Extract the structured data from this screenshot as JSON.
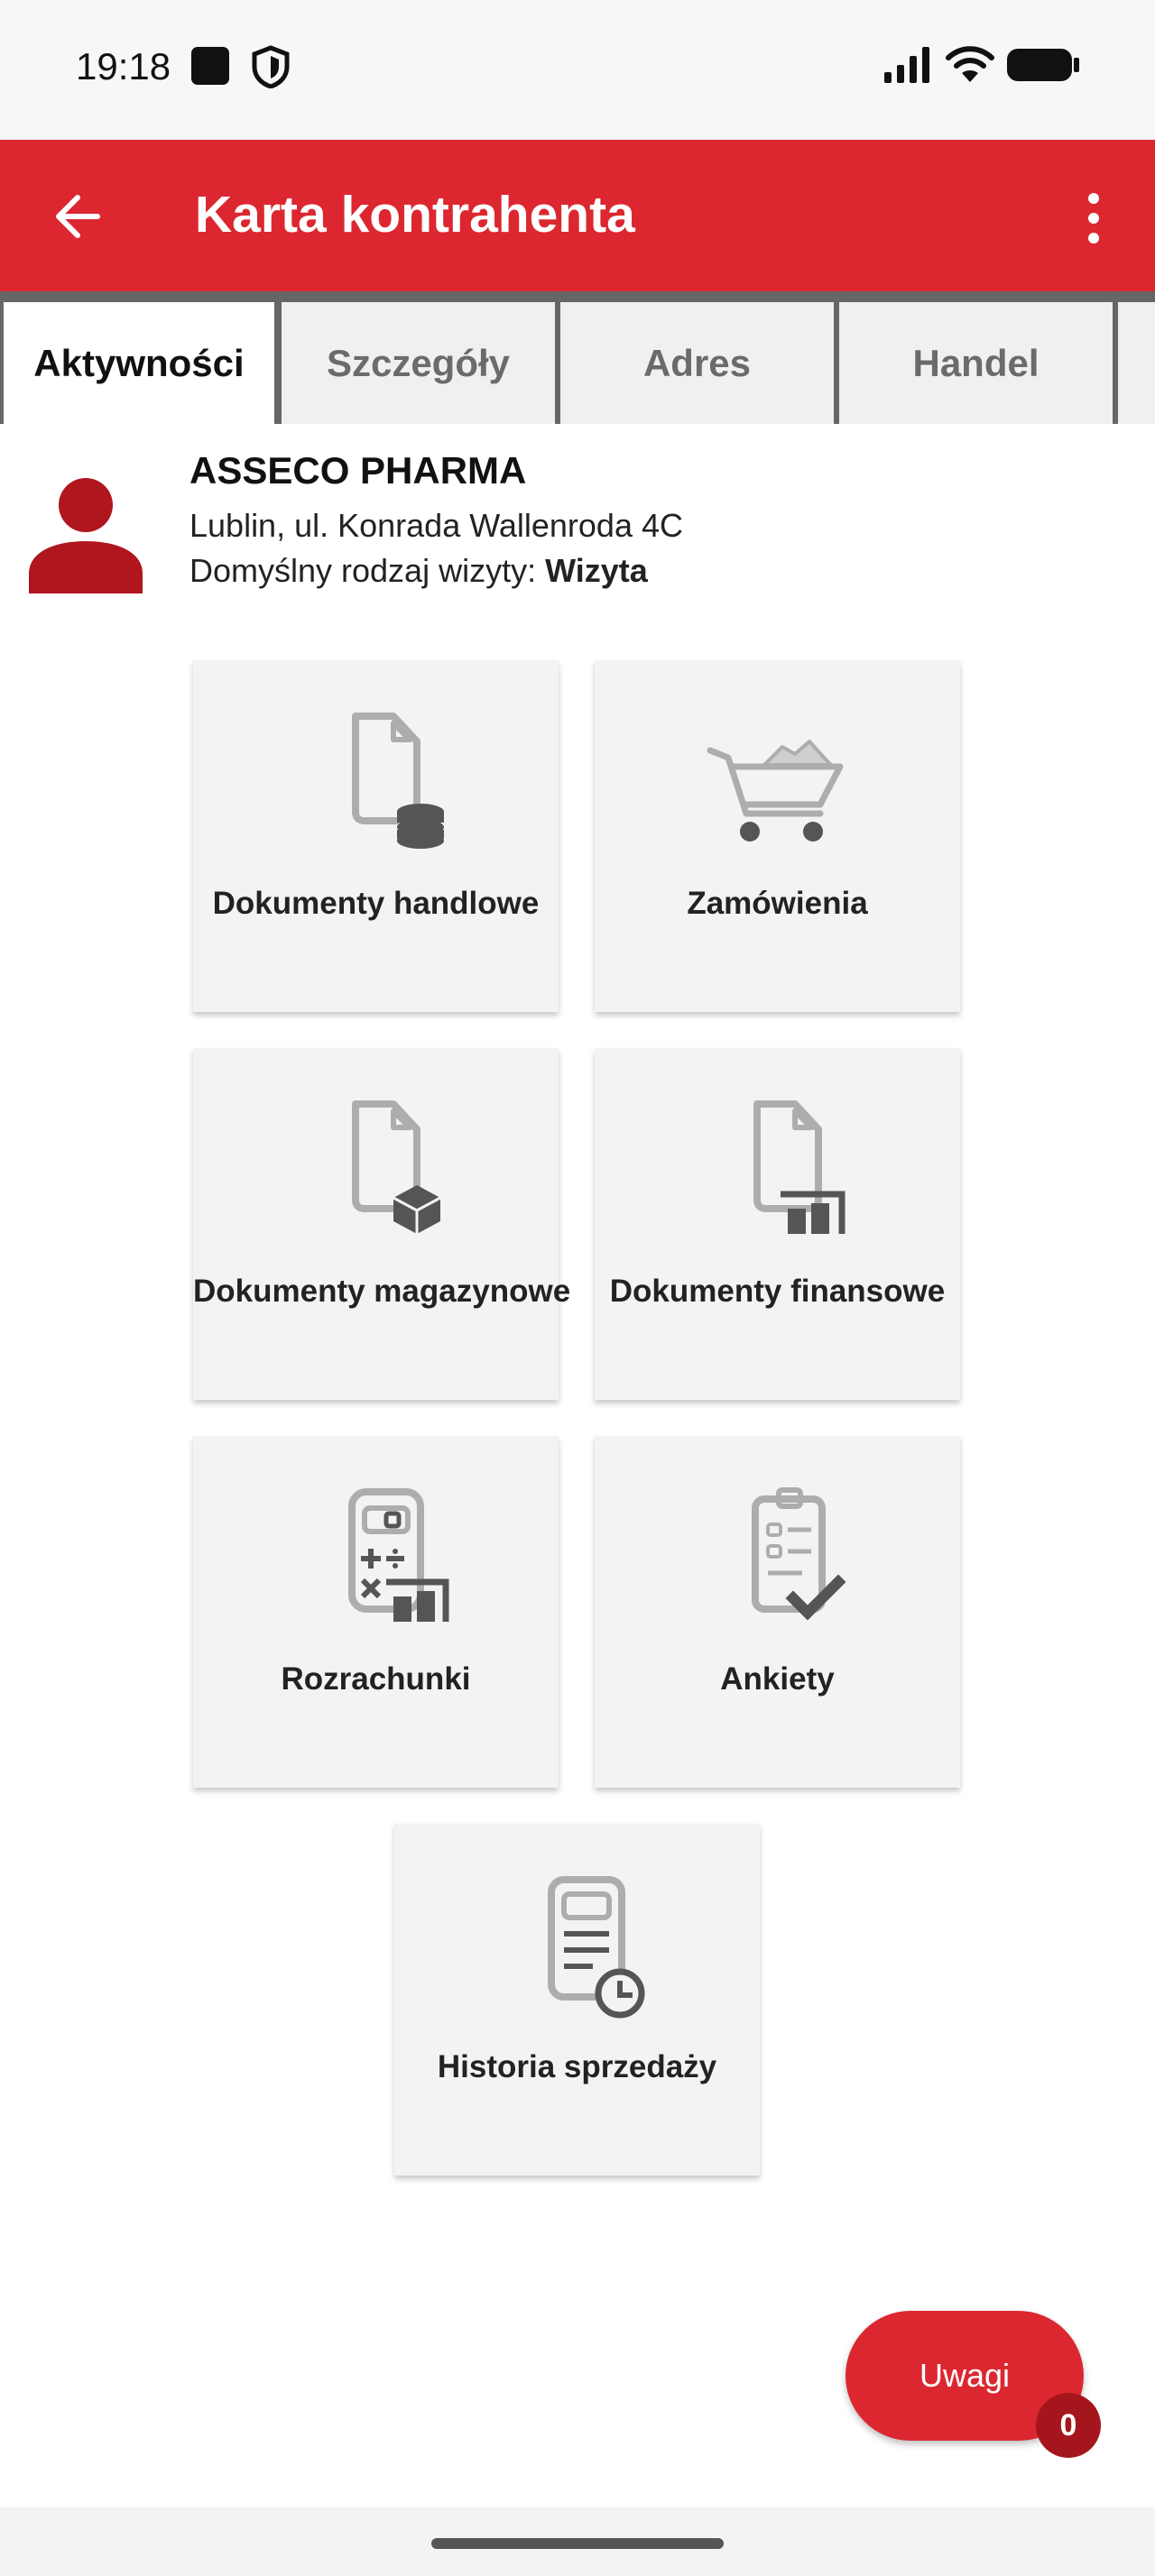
{
  "status_bar": {
    "time": "19:18"
  },
  "app_bar": {
    "title": "Karta kontrahenta"
  },
  "tabs": [
    {
      "label": "Aktywności",
      "active": true
    },
    {
      "label": "Szczegóły",
      "active": false
    },
    {
      "label": "Adres",
      "active": false
    },
    {
      "label": "Handel",
      "active": false
    }
  ],
  "contractor": {
    "name": "ASSECO PHARMA",
    "address": "Lublin, ul. Konrada Wallenroda 4C",
    "visit_type_label": "Domyślny rodzaj wizyty:",
    "visit_type_value": "Wizyta"
  },
  "tiles": [
    {
      "label": "Dokumenty handlowe",
      "icon": "document-database-icon"
    },
    {
      "label": "Zamówienia",
      "icon": "shopping-cart-icon"
    },
    {
      "label": "Dokumenty magazynowe",
      "icon": "document-box-icon"
    },
    {
      "label": "Dokumenty finansowe",
      "icon": "document-finance-icon"
    },
    {
      "label": "Rozrachunki",
      "icon": "calculator-icon"
    },
    {
      "label": "Ankiety",
      "icon": "clipboard-check-icon"
    },
    {
      "label": "Historia sprzedaży",
      "icon": "sales-history-icon"
    }
  ],
  "fab": {
    "label": "Uwagi",
    "count": "0"
  },
  "colors": {
    "primary": "#dc2730",
    "badge": "#a5161c",
    "tile_bg": "#f3f3f3"
  }
}
